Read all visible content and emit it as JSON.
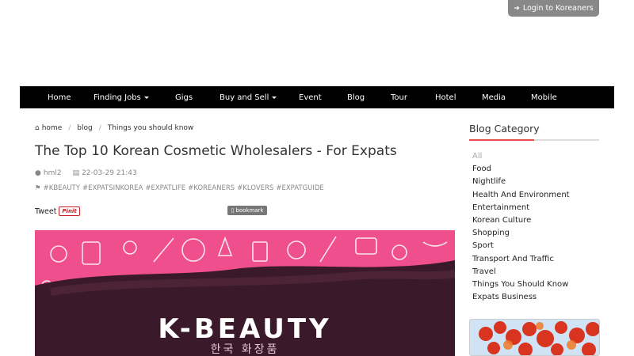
{
  "header": {
    "login_label": "Login to Koreaners",
    "login_icon": "sign-in-icon"
  },
  "nav": {
    "items": [
      {
        "label": "Home",
        "dropdown": false
      },
      {
        "label": "Finding Jobs",
        "dropdown": true
      },
      {
        "label": "Gigs",
        "dropdown": false
      },
      {
        "label": "Buy and Sell",
        "dropdown": true
      },
      {
        "label": "Event",
        "dropdown": false
      },
      {
        "label": "Blog",
        "dropdown": false
      },
      {
        "label": "Tour",
        "dropdown": false
      },
      {
        "label": "Hotel",
        "dropdown": false
      },
      {
        "label": "Media",
        "dropdown": false
      },
      {
        "label": "Mobile",
        "dropdown": false
      }
    ]
  },
  "breadcrumb": {
    "home": "home",
    "blog": "blog",
    "current": "Things you should know"
  },
  "article": {
    "title": "The Top 10 Korean Cosmetic Wholesalers - For Expats",
    "author": "hml2",
    "date": "22-03-29 21:43",
    "tags": [
      "#KBEAUTY",
      "#EXPATSINKOREA",
      "#EXPATLIFE",
      "#KOREANERS",
      "#KLOVERS",
      "#EXPATGUIDE"
    ],
    "tweet_label": "Tweet",
    "pinit_label": "Pinit",
    "bookmark_label": "bookmark",
    "hero_title": "K-BEAUTY",
    "hero_subtitle": "한국 화장품"
  },
  "sidebar": {
    "heading": "Blog Category",
    "categories": [
      "All",
      "Food",
      "Nightlife",
      "Health And Environment",
      "Entertainment",
      "Korean Culture",
      "Shopping",
      "Sport",
      "Transport And Traffic",
      "Travel",
      "Things You Should Know",
      "Expats Business"
    ],
    "active_category": "All"
  },
  "colors": {
    "nav_bg": "#000000",
    "login_bg": "#888888",
    "accent_line": "#e84d4d",
    "hero_pink": "#ef4f8c",
    "hero_dark": "#3a1a2a"
  }
}
